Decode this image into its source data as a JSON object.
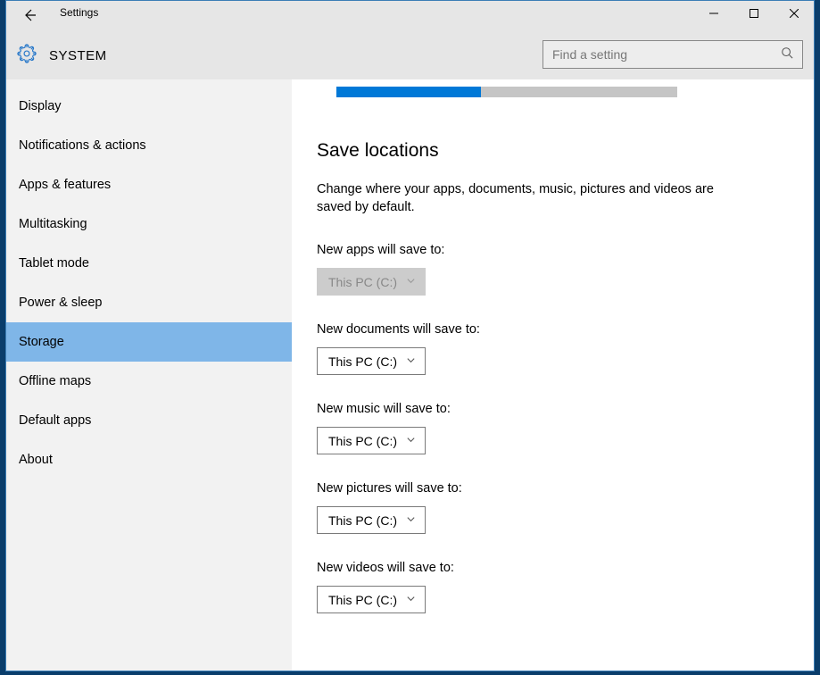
{
  "window": {
    "title": "Settings"
  },
  "header": {
    "section": "SYSTEM"
  },
  "search": {
    "placeholder": "Find a setting"
  },
  "sidebar": {
    "items": [
      {
        "label": "Display",
        "selected": false
      },
      {
        "label": "Notifications & actions",
        "selected": false
      },
      {
        "label": "Apps & features",
        "selected": false
      },
      {
        "label": "Multitasking",
        "selected": false
      },
      {
        "label": "Tablet mode",
        "selected": false
      },
      {
        "label": "Power & sleep",
        "selected": false
      },
      {
        "label": "Storage",
        "selected": true
      },
      {
        "label": "Offline maps",
        "selected": false
      },
      {
        "label": "Default apps",
        "selected": false
      },
      {
        "label": "About",
        "selected": false
      }
    ]
  },
  "content": {
    "progress_percent": 42.5,
    "heading": "Save locations",
    "description": "Change where your apps, documents, music, pictures and videos are saved by default.",
    "settings": [
      {
        "label": "New apps will save to:",
        "value": "This PC (C:)",
        "disabled": true
      },
      {
        "label": "New documents will save to:",
        "value": "This PC (C:)",
        "disabled": false
      },
      {
        "label": "New music will save to:",
        "value": "This PC (C:)",
        "disabled": false
      },
      {
        "label": "New pictures will save to:",
        "value": "This PC (C:)",
        "disabled": false
      },
      {
        "label": "New videos will save to:",
        "value": "This PC (C:)",
        "disabled": false
      }
    ]
  }
}
